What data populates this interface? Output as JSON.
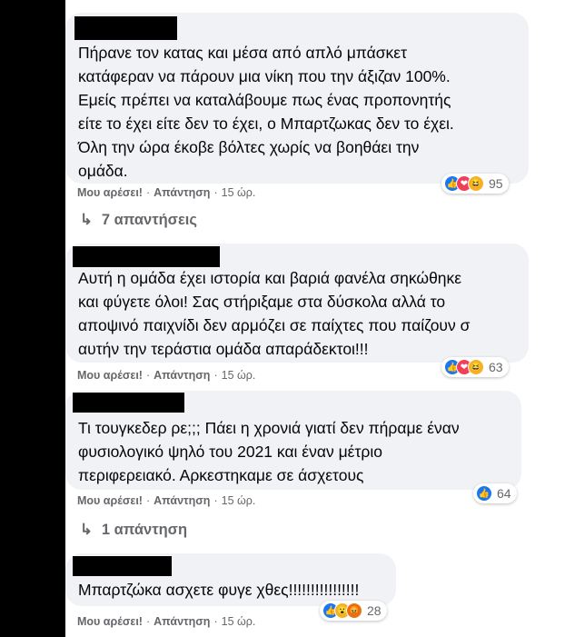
{
  "comments": [
    {
      "lines": [
        "Πήρανε τον κατας και μέσα από απλό μπάσκετ",
        "κατάφεραν να πάρουν μια νίκη που την άξιζαν 100%.",
        "Εμείς πρέπει να καταλάβουμε πως ένας προπονητής",
        "είτε το έχει είτε δεν το έχει, ο Μπαρτζωκας δεν το έχει.",
        "Όλη την ώρα έκοβε βόλτες χωρίς να βοηθάει την",
        "ομάδα."
      ],
      "like": "Μου αρέσει!",
      "reply": "Απάντηση",
      "time": "15 ώρ.",
      "reactions": [
        "like-icon",
        "love-icon",
        "haha-icon"
      ],
      "count": "95",
      "replies": "7 απαντήσεις"
    },
    {
      "lines": [
        "Αυτή η ομάδα έχει ιστορία και βαριά φανέλα σηκώθηκε",
        "και φύγετε όλοι! Σας στήριξαμε στα δύσκολα αλλά το",
        "αποψινό παιχνίδι δεν αρμόζει σε παίχτες που παίζουν σ",
        "αυτήν την τεράστια ομάδα απαράδεκτοι!!!"
      ],
      "like": "Μου αρέσει!",
      "reply": "Απάντηση",
      "time": "15 ώρ.",
      "reactions": [
        "like-icon",
        "love-icon",
        "haha-icon"
      ],
      "count": "63"
    },
    {
      "lines": [
        "Τι τουγκεδερ ρε;;; Πάει η χρονιά γιατί δεν πήραμε έναν",
        "φυσιολογικό ψηλό του 2021 και έναν μέτριο",
        "περιφερειακό. Αρκεστηκαμε σε άσχετους"
      ],
      "like": "Μου αρέσει!",
      "reply": "Απάντηση",
      "time": "15 ώρ.",
      "reactions": [
        "like-icon"
      ],
      "count": "64",
      "replies": "1 απάντηση"
    },
    {
      "lines": [
        "Μπαρτζώκα ασχετε φυγε χθες!!!!!!!!!!!!!!!!"
      ],
      "like": "Μου αρέσει!",
      "reply": "Απάντηση",
      "time": "15 ώρ.",
      "reactions": [
        "like-icon",
        "wow-icon",
        "angry-icon"
      ],
      "count": "28"
    }
  ]
}
